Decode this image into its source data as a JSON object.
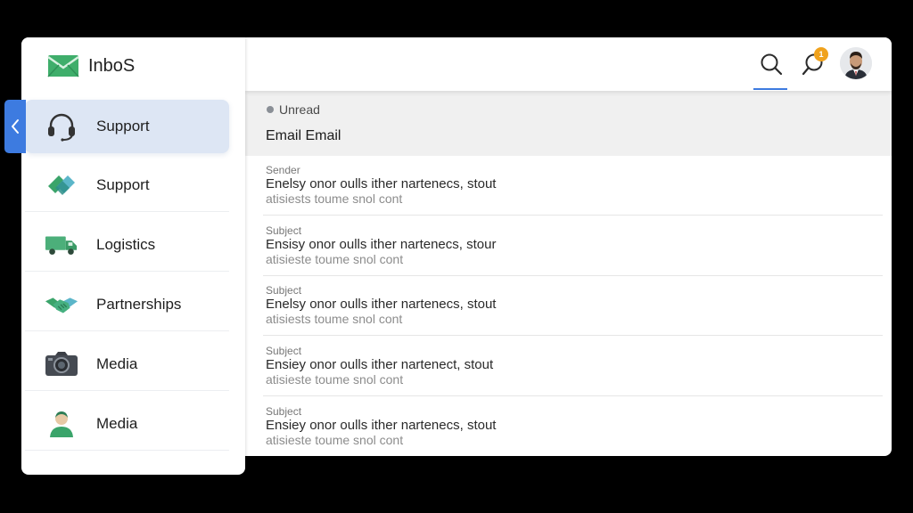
{
  "app": {
    "name": "InboS",
    "accent": "#3d7be0",
    "badge_color": "#f0a21c"
  },
  "sidebar": {
    "items": [
      {
        "label": "Support",
        "icon": "headset-icon",
        "active": true
      },
      {
        "label": "Support",
        "icon": "handshake-diamond-icon",
        "active": false
      },
      {
        "label": "Logistics",
        "icon": "truck-icon",
        "active": false
      },
      {
        "label": "Partnerships",
        "icon": "handshake-icon",
        "active": false
      },
      {
        "label": "Media",
        "icon": "camera-icon",
        "active": false
      },
      {
        "label": "Media",
        "icon": "person-icon",
        "active": false
      }
    ]
  },
  "topbar": {
    "notification_count": "1"
  },
  "list": {
    "filter_label": "Unread",
    "title": "Email Email",
    "emails": [
      {
        "field": "Sender",
        "line1": "Enelsy onor oulls ither nartenecs, stout",
        "line2": "atisiests toume snol cont"
      },
      {
        "field": "Subject",
        "line1": "Ensisy onor oulls ither nartenecs, stour",
        "line2": "atisieste toume snol cont"
      },
      {
        "field": "Subject",
        "line1": "Enelsy onor oulls ither nartenecs, stout",
        "line2": "atisiests toume snol cont"
      },
      {
        "field": "Subject",
        "line1": "Ensiey onor oulls ither nartenect, stout",
        "line2": "atisieste toume snol cont"
      },
      {
        "field": "Subject",
        "line1": "Ensiey onor oulls ither nartenecs, stout",
        "line2": "atisieste toume snol cont"
      }
    ]
  }
}
